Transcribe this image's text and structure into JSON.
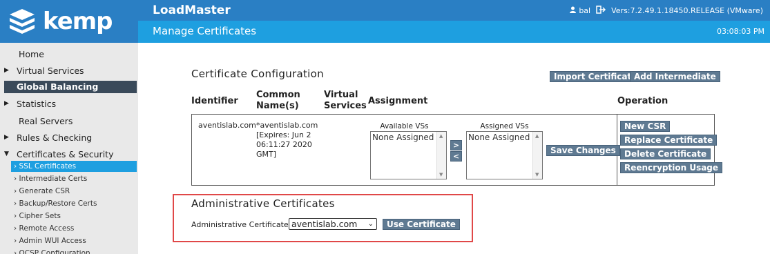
{
  "brand": {
    "logo_text": "kemp"
  },
  "header": {
    "app_title": "LoadMaster",
    "user": "bal",
    "version": "Vers:7.2.49.1.18450.RELEASE (VMware)",
    "page_title": "Manage Certificates",
    "clock": "03:08:03 PM"
  },
  "sidebar": {
    "items": [
      {
        "label": "Home",
        "arrow": ""
      },
      {
        "label": "Virtual Services",
        "arrow": "▶"
      },
      {
        "label": "Global Balancing",
        "arrow": ""
      },
      {
        "label": "Statistics",
        "arrow": "▶"
      },
      {
        "label": "Real Servers",
        "arrow": ""
      },
      {
        "label": "Rules & Checking",
        "arrow": "▶"
      },
      {
        "label": "Certificates & Security",
        "arrow": "▼"
      }
    ],
    "subitems": [
      "› SSL Certificates",
      "› Intermediate Certs",
      "› Generate CSR",
      "› Backup/Restore Certs",
      "› Cipher Sets",
      "› Remote Access",
      "› Admin WUI Access",
      "› OCSP Configuration"
    ]
  },
  "cert_config": {
    "title": "Certificate Configuration",
    "import_button": "Import Certificate",
    "add_intermediate_button": "Add Intermediate",
    "columns": {
      "identifier": "Identifier",
      "common_name_1": "Common",
      "common_name_2": "Name(s)",
      "virtual_1": "Virtual",
      "virtual_2": "Services",
      "assignment": "Assignment",
      "operation": "Operation"
    },
    "row": {
      "identifier": "aventislab.com",
      "common_name": "*aventislab.com",
      "expires_1": "[Expires: Jun 2",
      "expires_2": "06:11:27 2020",
      "expires_3": "GMT]",
      "available_label": "Available VSs",
      "assigned_label": "Assigned VSs",
      "available_value": "None Assigned",
      "assigned_value": "None Assigned",
      "move_right": ">",
      "move_left": "<",
      "save_button": "Save Changes",
      "ops": [
        "New CSR",
        "Replace Certificate",
        "Delete Certificate",
        "Reencryption Usage"
      ]
    }
  },
  "admin_certs": {
    "title": "Administrative Certificates",
    "label": "Administrative Certificate",
    "selected": "aventislab.com",
    "use_button": "Use Certificate"
  }
}
